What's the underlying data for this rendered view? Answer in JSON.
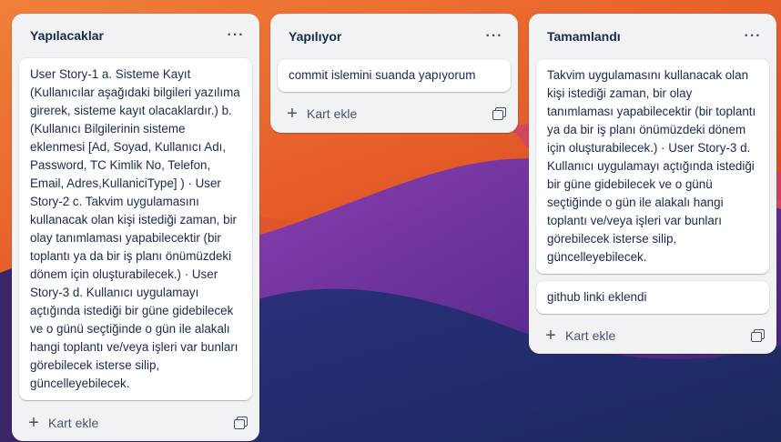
{
  "board": {
    "lists": [
      {
        "title": "Yapılacaklar",
        "menu": "···",
        "cards": [
          "User Story-1 a. Sisteme Kayıt (Kullanıcılar aşağıdaki bilgileri yazılıma girerek, sisteme kayıt olacaklardır.) b. (Kullanıcı Bilgilerinin sisteme eklenmesi [Ad, Soyad, Kullanıcı Adı, Password, TC Kimlik No, Telefon, Email, Adres,KullaniciType] ) · User Story-2 c. Takvim uygulamasını kullanacak olan kişi istediği zaman, bir olay tanımlaması yapabilecektir (bir toplantı ya da bir iş planı önümüzdeki dönem için oluşturabilecek.) · User Story-3 d. Kullanıcı uygulamayı açtığında istediği bir güne gidebilecek ve o günü seçtiğinde o gün ile alakalı hangi toplantı ve/veya işleri var bunları görebilecek isterse silip, güncelleyebilecek."
        ],
        "add_card": "Kart ekle"
      },
      {
        "title": "Yapılıyor",
        "menu": "···",
        "cards": [
          "commit islemini suanda yapıyorum"
        ],
        "add_card": "Kart ekle"
      },
      {
        "title": "Tamamlandı",
        "menu": "···",
        "cards": [
          "Takvim uygulamasını kullanacak olan kişi istediği zaman, bir olay tanımlaması yapabilecektir (bir toplantı ya da bir iş planı önümüzdeki dönem için oluşturabilecek.) · User Story-3 d. Kullanıcı uygulamayı açtığında istediği bir güne gidebilecek ve o günü seçtiğinde o gün ile alakalı hangi toplantı ve/veya işleri var bunları görebilecek isterse silip, güncelleyebilecek.",
          "github linki eklendi"
        ],
        "add_card": "Kart ekle"
      }
    ]
  },
  "icons": {
    "menu": "more-horizontal-icon",
    "add": "plus-icon",
    "template": "card-template-icon"
  },
  "colors": {
    "list_bg": "#f1f2f4",
    "card_bg": "#ffffff",
    "text": "#172b4d",
    "subtle_text": "#44546f"
  }
}
